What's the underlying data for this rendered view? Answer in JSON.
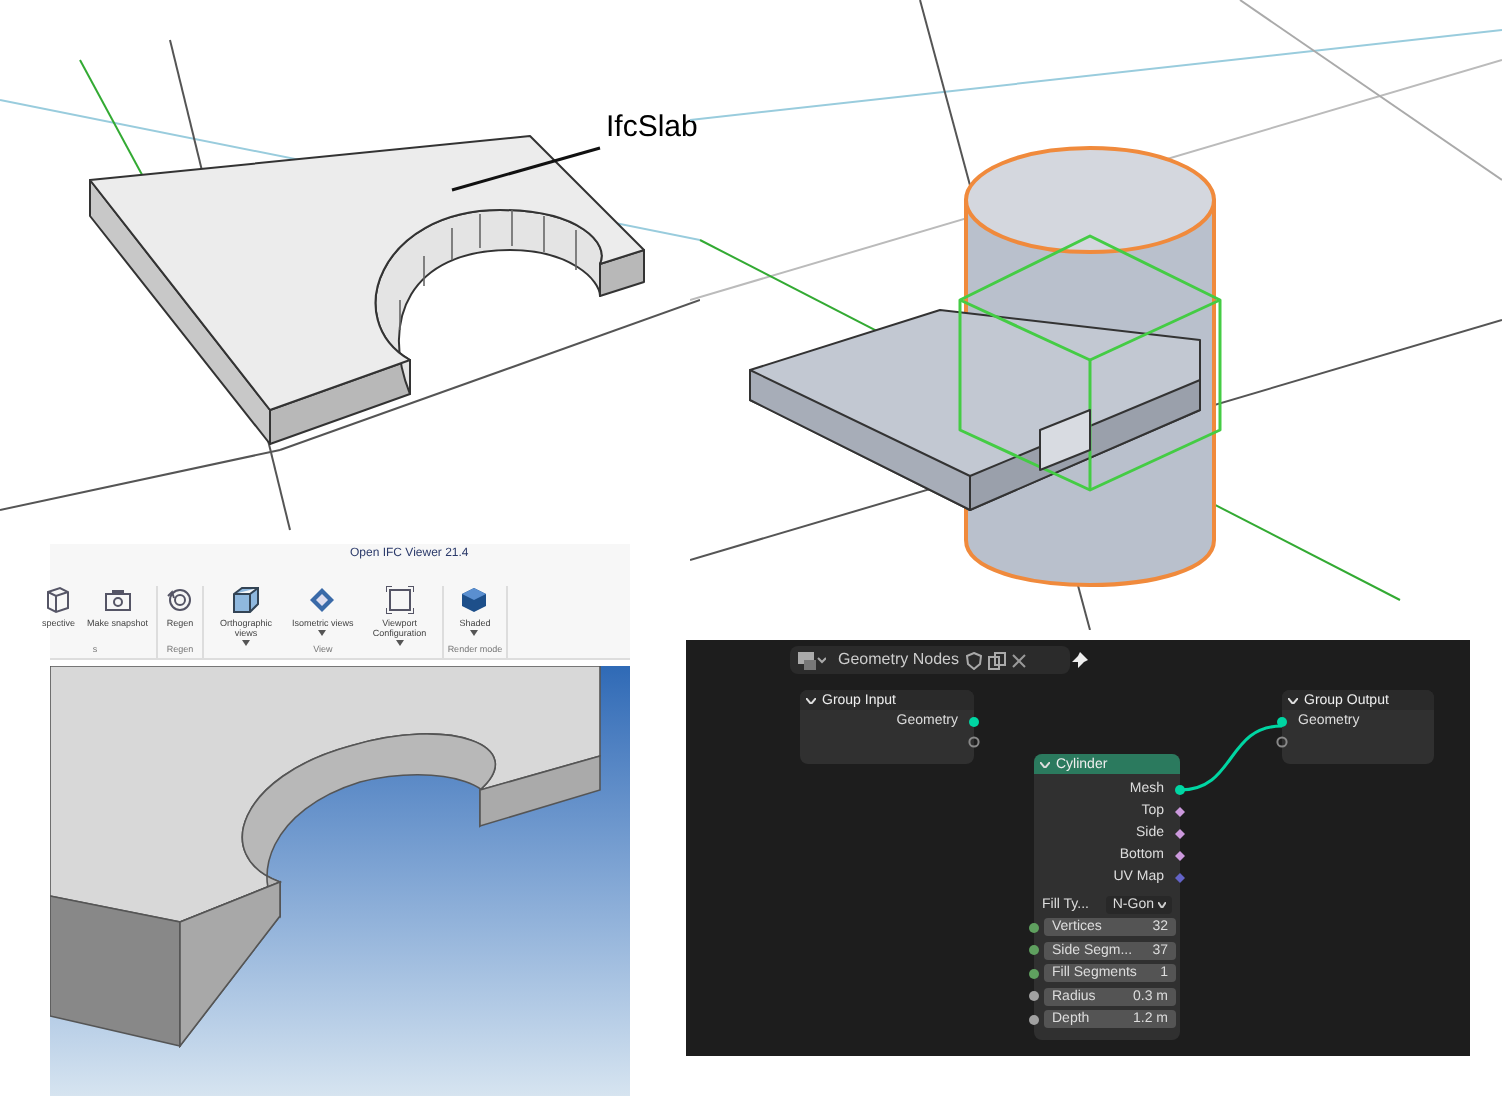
{
  "slab_view": {
    "label": "IfcSlab"
  },
  "ifc_viewer": {
    "title": "Open IFC Viewer 21.4",
    "groups": [
      {
        "label": "s",
        "buttons": [
          {
            "label": "spective",
            "kind": "cube",
            "dropdown": false
          },
          {
            "label": "Make snapshot",
            "kind": "camera",
            "dropdown": false
          }
        ]
      },
      {
        "label": "Regen",
        "buttons": [
          {
            "label": "Regen",
            "kind": "regen",
            "dropdown": false
          }
        ]
      },
      {
        "label": "View",
        "buttons": [
          {
            "label": "Orthographic views",
            "kind": "box",
            "dropdown": true
          },
          {
            "label": "Isometric views",
            "kind": "diamond",
            "dropdown": true
          },
          {
            "label": "Viewport Configuration",
            "kind": "frame",
            "dropdown": true
          }
        ]
      },
      {
        "label": "Render mode",
        "buttons": [
          {
            "label": "Shaded",
            "kind": "shaded",
            "dropdown": true
          }
        ]
      }
    ]
  },
  "node_editor": {
    "title": "Geometry Nodes",
    "group_input": {
      "title": "Group Input",
      "outputs": [
        {
          "label": "Geometry",
          "color": "#00d6a3"
        }
      ]
    },
    "group_output": {
      "title": "Group Output",
      "inputs": [
        {
          "label": "Geometry",
          "color": "#00d6a3"
        }
      ]
    },
    "cylinder": {
      "title": "Cylinder",
      "outputs": [
        {
          "label": "Mesh",
          "color": "#00d6a3",
          "kind": "circle"
        },
        {
          "label": "Top",
          "color": "#cc99dd",
          "kind": "diamond"
        },
        {
          "label": "Side",
          "color": "#cc99dd",
          "kind": "diamond"
        },
        {
          "label": "Bottom",
          "color": "#cc99dd",
          "kind": "diamond"
        },
        {
          "label": "UV Map",
          "color": "#6363c7",
          "kind": "diamond"
        }
      ],
      "fill_type": {
        "label": "Fill Ty...",
        "value": "N-Gon"
      },
      "inputs": [
        {
          "label": "Vertices",
          "value": "32",
          "color": "#5fa05f"
        },
        {
          "label": "Side Segm...",
          "value": "37",
          "color": "#5fa05f"
        },
        {
          "label": "Fill Segments",
          "value": "1",
          "color": "#5fa05f"
        },
        {
          "label": "Radius",
          "value": "0.3 m",
          "color": "#a1a1a1"
        },
        {
          "label": "Depth",
          "value": "1.2 m",
          "color": "#a1a1a1"
        }
      ]
    }
  }
}
